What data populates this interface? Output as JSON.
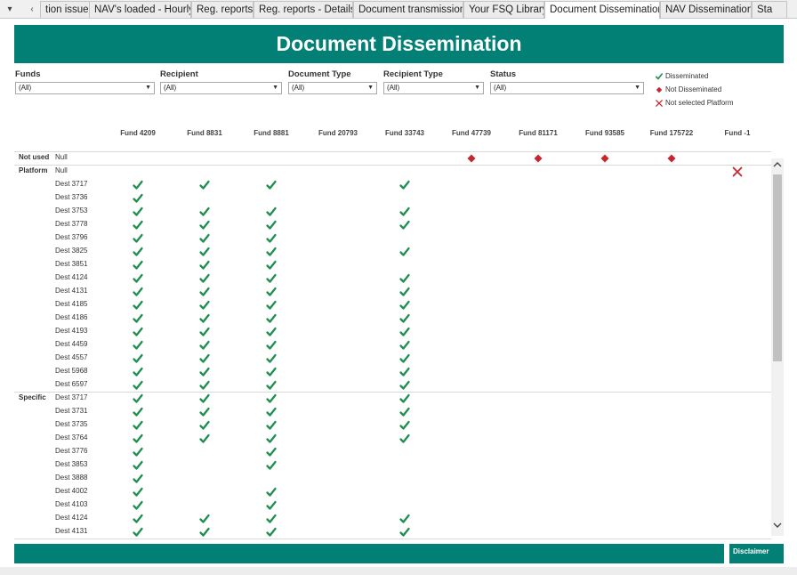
{
  "tabs": {
    "items": [
      {
        "label": "tion issues"
      },
      {
        "label": "NAV's loaded - Hourly"
      },
      {
        "label": "Reg. reports"
      },
      {
        "label": "Reg. reports - Details"
      },
      {
        "label": "Document transmission"
      },
      {
        "label": "Your FSQ Library"
      },
      {
        "label": "Document Dissemination"
      },
      {
        "label": "NAV Dissemination"
      },
      {
        "label": "Sta"
      }
    ],
    "active_index": 6
  },
  "header": {
    "title": "Document Dissemination"
  },
  "filters": [
    {
      "label": "Funds",
      "value": "(All)"
    },
    {
      "label": "Recipient",
      "value": "(All)"
    },
    {
      "label": "Document Type",
      "value": "(All)"
    },
    {
      "label": "Recipient Type",
      "value": "(All)"
    },
    {
      "label": "Status",
      "value": "(All)"
    }
  ],
  "legend": [
    {
      "label": "Disseminated",
      "icon": "check-icon",
      "color": "#1e8f4e"
    },
    {
      "label": "Not Disseminated",
      "icon": "diamond-icon",
      "color": "#c6262e"
    },
    {
      "label": "Not selected Platform",
      "icon": "cross-icon",
      "color": "#c6262e"
    }
  ],
  "columns": [
    "Fund 4209",
    "Fund 8831",
    "Fund 8881",
    "Fund 20793",
    "Fund 33743",
    "Fund 47739",
    "Fund 81171",
    "Fund 93585",
    "Fund 175722",
    "Fund -1"
  ],
  "groups": [
    {
      "label": "Not used",
      "rows": [
        {
          "label": "Null",
          "marks": {
            "5": "diamond",
            "6": "diamond",
            "7": "diamond",
            "8": "diamond"
          }
        }
      ]
    },
    {
      "label": "Platform",
      "rows": [
        {
          "label": "Null",
          "marks": {
            "9": "cross"
          }
        },
        {
          "label": "Dest 3717",
          "marks": {
            "0": "check",
            "1": "check",
            "2": "check",
            "4": "check"
          }
        },
        {
          "label": "Dest 3736",
          "marks": {
            "0": "check"
          }
        },
        {
          "label": "Dest 3753",
          "marks": {
            "0": "check",
            "1": "check",
            "2": "check",
            "4": "check"
          }
        },
        {
          "label": "Dest 3778",
          "marks": {
            "0": "check",
            "1": "check",
            "2": "check",
            "4": "check"
          }
        },
        {
          "label": "Dest 3796",
          "marks": {
            "0": "check",
            "1": "check",
            "2": "check"
          }
        },
        {
          "label": "Dest 3825",
          "marks": {
            "0": "check",
            "1": "check",
            "2": "check",
            "4": "check"
          }
        },
        {
          "label": "Dest 3851",
          "marks": {
            "0": "check",
            "1": "check",
            "2": "check"
          }
        },
        {
          "label": "Dest 4124",
          "marks": {
            "0": "check",
            "1": "check",
            "2": "check",
            "4": "check"
          }
        },
        {
          "label": "Dest 4131",
          "marks": {
            "0": "check",
            "1": "check",
            "2": "check",
            "4": "check"
          }
        },
        {
          "label": "Dest 4185",
          "marks": {
            "0": "check",
            "1": "check",
            "2": "check",
            "4": "check"
          }
        },
        {
          "label": "Dest 4186",
          "marks": {
            "0": "check",
            "1": "check",
            "2": "check",
            "4": "check"
          }
        },
        {
          "label": "Dest 4193",
          "marks": {
            "0": "check",
            "1": "check",
            "2": "check",
            "4": "check"
          }
        },
        {
          "label": "Dest 4459",
          "marks": {
            "0": "check",
            "1": "check",
            "2": "check",
            "4": "check"
          }
        },
        {
          "label": "Dest 4557",
          "marks": {
            "0": "check",
            "1": "check",
            "2": "check",
            "4": "check"
          }
        },
        {
          "label": "Dest 5968",
          "marks": {
            "0": "check",
            "1": "check",
            "2": "check",
            "4": "check"
          }
        },
        {
          "label": "Dest 6597",
          "marks": {
            "0": "check",
            "1": "check",
            "2": "check",
            "4": "check"
          }
        }
      ]
    },
    {
      "label": "Specific",
      "rows": [
        {
          "label": "Dest 3717",
          "marks": {
            "0": "check",
            "1": "check",
            "2": "check",
            "4": "check"
          }
        },
        {
          "label": "Dest 3731",
          "marks": {
            "0": "check",
            "1": "check",
            "2": "check",
            "4": "check"
          }
        },
        {
          "label": "Dest 3735",
          "marks": {
            "0": "check",
            "1": "check",
            "2": "check",
            "4": "check"
          }
        },
        {
          "label": "Dest 3764",
          "marks": {
            "0": "check",
            "1": "check",
            "2": "check",
            "4": "check"
          }
        },
        {
          "label": "Dest 3776",
          "marks": {
            "0": "check",
            "2": "check"
          }
        },
        {
          "label": "Dest 3853",
          "marks": {
            "0": "check",
            "2": "check"
          }
        },
        {
          "label": "Dest 3888",
          "marks": {
            "0": "check"
          }
        },
        {
          "label": "Dest 4002",
          "marks": {
            "0": "check",
            "2": "check"
          }
        },
        {
          "label": "Dest 4103",
          "marks": {
            "0": "check",
            "2": "check"
          }
        },
        {
          "label": "Dest 4124",
          "marks": {
            "0": "check",
            "1": "check",
            "2": "check",
            "4": "check"
          }
        },
        {
          "label": "Dest 4131",
          "marks": {
            "0": "check",
            "1": "check",
            "2": "check",
            "4": "check"
          }
        }
      ]
    }
  ],
  "footer": {
    "disclaimer_label": "Disclaimer"
  },
  "colors": {
    "accent": "#038075",
    "check": "#1e8f4e",
    "not_disseminated": "#c6262e"
  }
}
